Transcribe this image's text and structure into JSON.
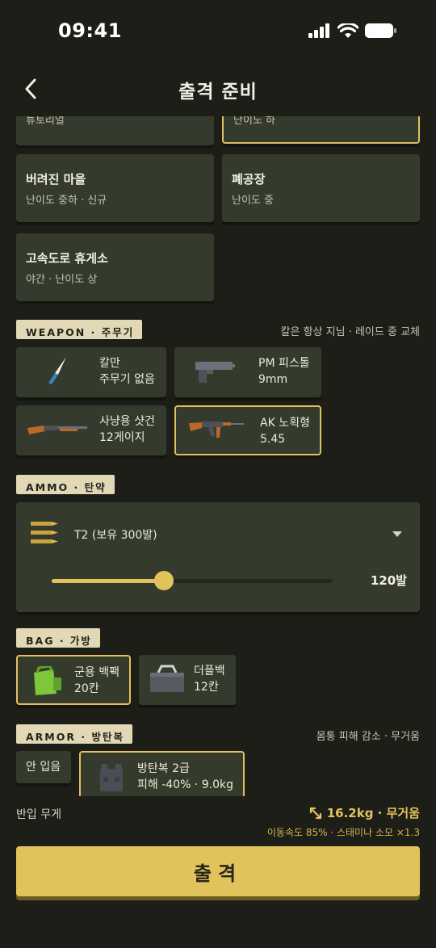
{
  "status_bar": {
    "time": "09:41"
  },
  "nav": {
    "title": "출격 준비"
  },
  "maps": [
    {
      "name": "",
      "desc": "튜토리얼",
      "selected": false
    },
    {
      "name": "",
      "desc": "난이도 하",
      "selected": true
    },
    {
      "name": "버려진 마을",
      "desc": "난이도 중하 · 신규",
      "selected": false
    },
    {
      "name": "폐공장",
      "desc": "난이도 중",
      "selected": false
    },
    {
      "name": "고속도로 휴게소",
      "desc": "야간 · 난이도 상",
      "selected": false
    }
  ],
  "weapon": {
    "tag": "WEAPON · 주무기",
    "note": "칼은 항상 지님 · 레이드 중 교체",
    "items": [
      {
        "line1": "칼만",
        "line2": "주무기 없음",
        "icon": "knife-icon",
        "selected": false
      },
      {
        "line1": "PM 피스톨",
        "line2": "9mm",
        "icon": "pistol-icon",
        "selected": false
      },
      {
        "line1": "사냥용 샷건",
        "line2": "12게이지",
        "icon": "shotgun-icon",
        "selected": false
      },
      {
        "line1": "AK 노획형",
        "line2": "5.45",
        "icon": "rifle-icon",
        "selected": true
      }
    ]
  },
  "ammo": {
    "tag": "AMMO · 탄약",
    "type": "T2 (보유 300발)",
    "count_label": "120발",
    "slider_fraction": 0.4
  },
  "bag": {
    "tag": "BAG · 가방",
    "items": [
      {
        "line1": "군용 백팩",
        "line2": "20칸",
        "icon": "backpack-icon",
        "selected": true
      },
      {
        "line1": "더플백",
        "line2": "12칸",
        "icon": "duffel-bag-icon",
        "selected": false
      }
    ]
  },
  "armor": {
    "tag": "ARMOR · 방탄복",
    "note": "몸통 피해 감소 · 무거움",
    "none_label": "안 입음",
    "item": {
      "line1": "방탄복 2급",
      "line2": "피해 -40% · 9.0kg",
      "icon": "vest-icon",
      "selected": true
    }
  },
  "footer": {
    "weight_label": "반입 무게",
    "weight_value": "16.2kg · 무거움",
    "weight_effect": "이동속도 85% · 스태미나 소모 ×1.3",
    "launch_label": "출격"
  },
  "colors": {
    "accent": "#e2c35b",
    "card": "#353b2c",
    "background": "#1d1e18",
    "tag": "#e2d8b6"
  }
}
